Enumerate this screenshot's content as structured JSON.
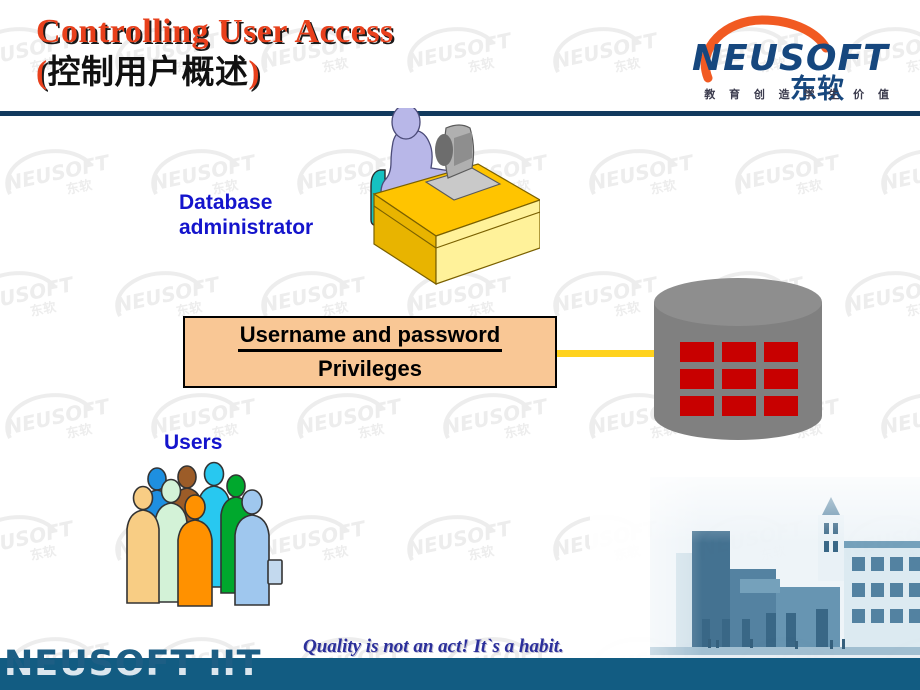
{
  "slide": {
    "title_en": "Controlling User Access",
    "title_cn_open": "(",
    "title_cn": "控制用户概述",
    "title_cn_close": ")",
    "title_color": "#E8401C",
    "divider_color": "#123A5E",
    "background_color": "#FFFFFF"
  },
  "logo": {
    "name": "NEUSOFT",
    "name_cn": "东软",
    "tagline": "教 育 创 造 学 生 价 值",
    "arc_color": "#F15A22",
    "text_color": "#16477E"
  },
  "labels": {
    "dba": "Database\nadministrator",
    "users": "Users",
    "label_color": "#1414CC"
  },
  "credentials_box": {
    "line1": "Username and password",
    "line2": "Privileges",
    "fill_color": "#F9C795",
    "border_color": "#000000"
  },
  "connector": {
    "color": "#FFD21E"
  },
  "database": {
    "body_color": "#808080",
    "top_color": "#8E8E8E",
    "cell_color": "#C80000",
    "rows": 3,
    "columns": 3
  },
  "desk": {
    "desktop_color": "#FFC400",
    "front_color": "#FFF29A",
    "person_color": "#B8B7E8",
    "chair_color": "#16C1C1",
    "monitor_color": "#A8A8A8"
  },
  "users_group": {
    "colors": [
      "#F8CD84",
      "#1E8FE0",
      "#D3F2D7",
      "#9C5C28",
      "#FF9100",
      "#28C8F0",
      "#00A82D",
      "#9FC7EE"
    ],
    "count": 8
  },
  "watermark": {
    "text": "NEUSOFT",
    "text_cn": "东软",
    "color": "#EDEDED"
  },
  "footer": {
    "brand": "NEUSOFT IIT",
    "quote": "Quality is not an act! It`s a habit.",
    "band_color": "#125C82",
    "quote_color": "#2B2F9B",
    "brand_color": "#1D5E84"
  }
}
